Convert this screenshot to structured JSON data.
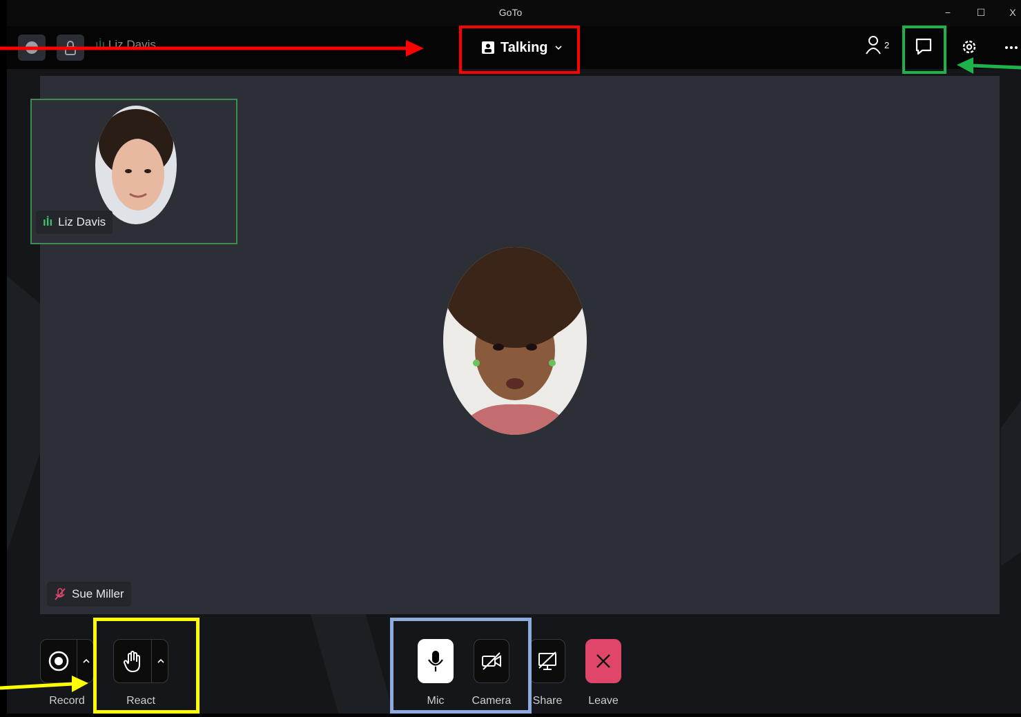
{
  "window": {
    "title": "GoTo",
    "minimize": "−",
    "maximize": "☐",
    "close": "X"
  },
  "topbar": {
    "speaker_name": "Liz Davis",
    "view_mode": "Talking",
    "participant_count": "2"
  },
  "participants": [
    {
      "name": "Liz Davis",
      "status": "talking"
    },
    {
      "name": "Sue Miller",
      "status": "muted"
    }
  ],
  "controls": {
    "record_label": "Record",
    "react_label": "React",
    "mic_label": "Mic",
    "camera_label": "Camera",
    "share_label": "Share",
    "leave_label": "Leave"
  },
  "icons": [
    "mic-icon",
    "camera-off-icon",
    "share-off-icon",
    "close-icon",
    "raise-hand-icon",
    "record-icon",
    "chat-icon",
    "gear-icon",
    "more-icon",
    "person-icon",
    "audio-level-icon",
    "mic-muted-icon"
  ],
  "colors": {
    "annotation_red": "#ff0000",
    "annotation_green": "#1db34a",
    "annotation_yellow": "#ffff00",
    "annotation_blue": "#8faadc",
    "leave_red": "#e0456a",
    "talking_green": "#3fbf6a"
  }
}
